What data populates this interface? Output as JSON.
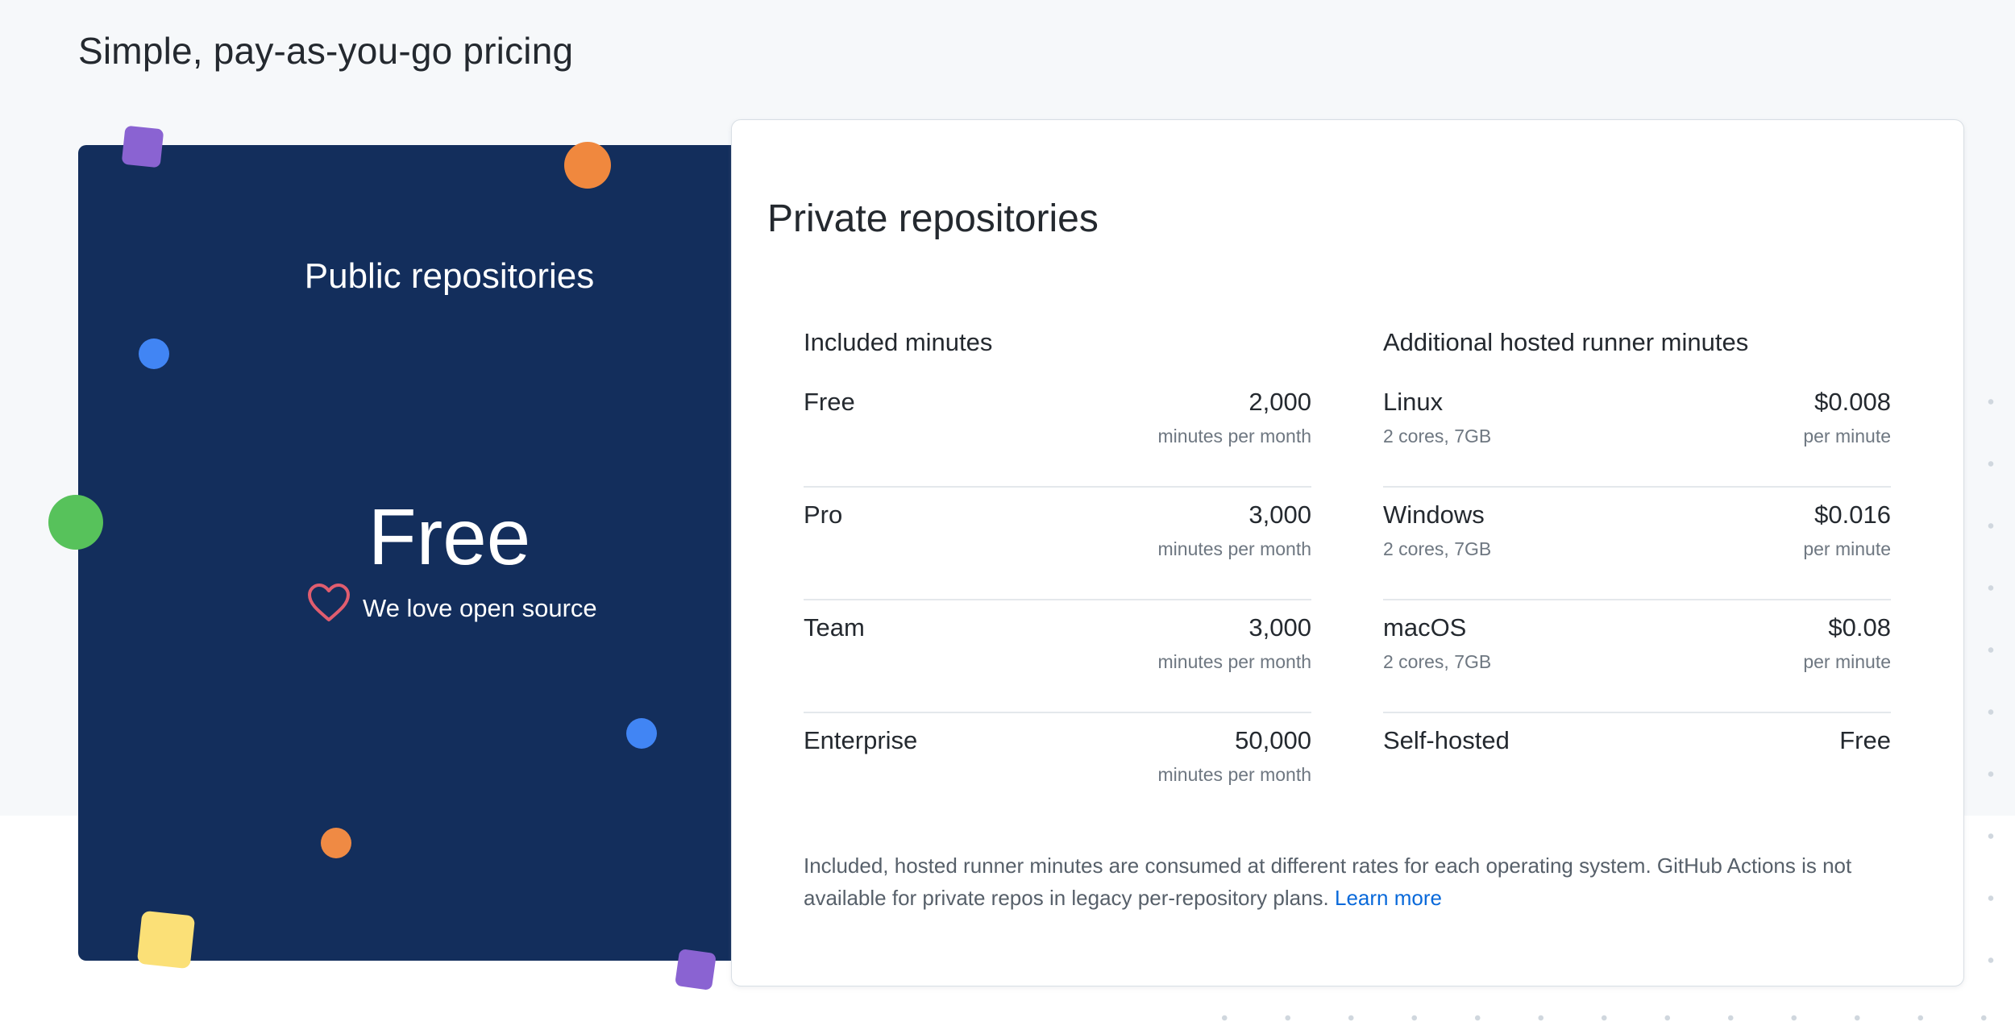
{
  "page": {
    "title": "Simple, pay-as-you-go pricing"
  },
  "public": {
    "title": "Public repositories",
    "price": "Free",
    "tagline": "We love open source",
    "tagline_icon": "heart-icon",
    "background_color": "#132e5c"
  },
  "private": {
    "title": "Private repositories",
    "included": {
      "heading": "Included minutes",
      "rows": [
        {
          "name": "Free",
          "value": "2,000",
          "unit": "minutes per month"
        },
        {
          "name": "Pro",
          "value": "3,000",
          "unit": "minutes per month"
        },
        {
          "name": "Team",
          "value": "3,000",
          "unit": "minutes per month"
        },
        {
          "name": "Enterprise",
          "value": "50,000",
          "unit": "minutes per month"
        }
      ]
    },
    "additional": {
      "heading": "Additional hosted runner minutes",
      "rows": [
        {
          "name": "Linux",
          "spec": "2 cores, 7GB",
          "value": "$0.008",
          "unit": "per minute"
        },
        {
          "name": "Windows",
          "spec": "2 cores, 7GB",
          "value": "$0.016",
          "unit": "per minute"
        },
        {
          "name": "macOS",
          "spec": "2 cores, 7GB",
          "value": "$0.08",
          "unit": "per minute"
        },
        {
          "name": "Self-hosted",
          "value": "Free"
        }
      ]
    },
    "footnote": "Included, hosted runner minutes are consumed at different rates for each operating system. GitHub Actions is not available for private repos in legacy per-repository plans.",
    "learn_more": "Learn more",
    "link_color": "#0969da"
  }
}
